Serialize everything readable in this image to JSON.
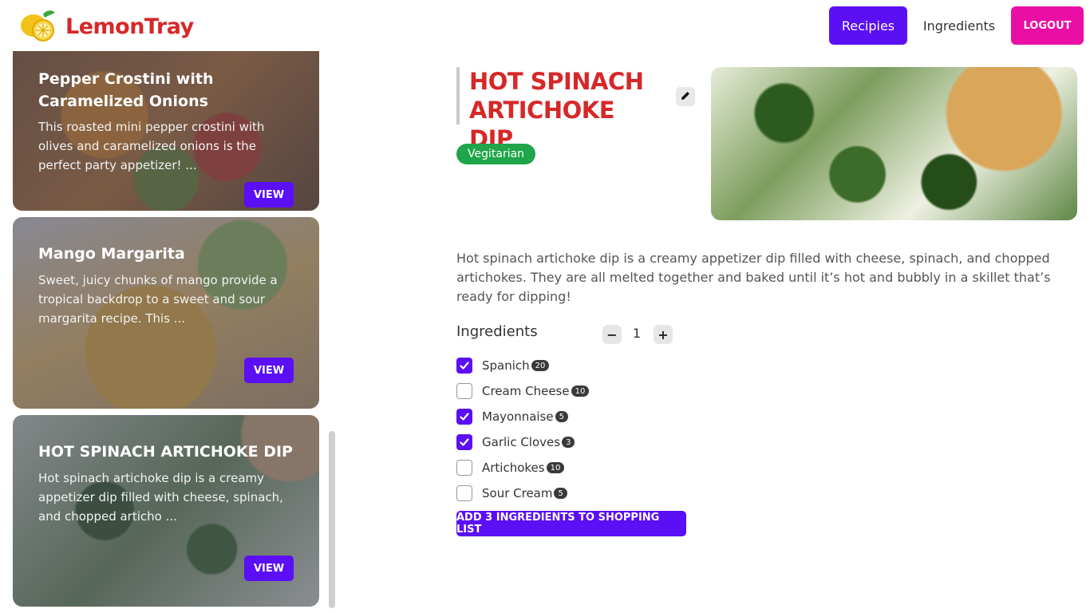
{
  "header": {
    "brand": "LemonTray",
    "nav": {
      "recipes": "Recipies",
      "ingredients": "Ingredients",
      "logout": "LOGOUT"
    }
  },
  "recipe_list": [
    {
      "title": "Pepper Crostini with Caramelized Onions",
      "description": "This roasted mini pepper crostini with olives and caramelized onions is the perfect party appetizer! ...",
      "view_label": "VIEW"
    },
    {
      "title": "Mango Margarita",
      "description": "Sweet, juicy chunks of mango provide a tropical backdrop to a sweet and sour margarita recipe. This ...",
      "view_label": "VIEW"
    },
    {
      "title": "HOT SPINACH ARTICHOKE DIP",
      "description": "Hot spinach artichoke dip is a creamy appetizer dip filled with cheese, spinach, and chopped articho ...",
      "view_label": "VIEW"
    }
  ],
  "detail": {
    "title": "HOT SPINACH ARTICHOKE DIP",
    "tag": "Vegitarian",
    "description": "Hot spinach artichoke dip is a creamy appetizer dip filled with cheese, spinach, and chopped artichokes. They are all melted together and baked until it’s hot and bubbly in a skillet that’s ready for dipping!",
    "ingredients_heading": "Ingredients",
    "quantity": "1",
    "minus_label": "−",
    "plus_label": "+",
    "ingredients": [
      {
        "name": "Spanich",
        "count": "20",
        "checked": true
      },
      {
        "name": "Cream Cheese",
        "count": "10",
        "checked": false
      },
      {
        "name": "Mayonnaise",
        "count": "5",
        "checked": true
      },
      {
        "name": "Garlic Cloves",
        "count": "3",
        "checked": true
      },
      {
        "name": "Artichokes",
        "count": "10",
        "checked": false
      },
      {
        "name": "Sour Cream",
        "count": "5",
        "checked": false
      }
    ],
    "add_button": "ADD 3 INGREDIENTS TO SHOPPING LIST"
  },
  "colors": {
    "brand_red": "#d62828",
    "primary": "#5b0ff5",
    "logout_pink": "#e90fa5",
    "tag_green": "#1fa54a"
  }
}
